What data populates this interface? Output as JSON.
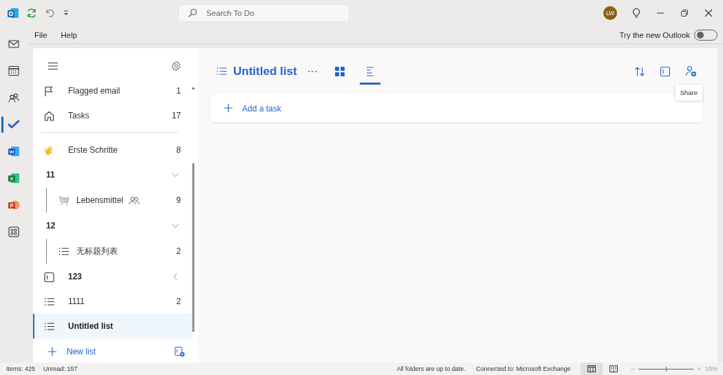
{
  "title_bar": {
    "search": {
      "placeholder": "Search To Do"
    },
    "avatar": "LW"
  },
  "menu_bar": {
    "items": [
      "File",
      "Help"
    ],
    "new_outlook": {
      "label": "Try the new Outlook",
      "on": false
    }
  },
  "app_rail": [
    {
      "kind": "mail",
      "selected": false
    },
    {
      "kind": "calendar",
      "selected": false
    },
    {
      "kind": "people",
      "selected": false
    },
    {
      "kind": "todo",
      "selected": true
    },
    {
      "kind": "word",
      "selected": false
    },
    {
      "kind": "excel",
      "selected": false
    },
    {
      "kind": "powerpoint",
      "selected": false
    },
    {
      "kind": "apps",
      "selected": false
    }
  ],
  "sidebar": {
    "lists": [
      {
        "kind": "flagged",
        "label": "Flagged email",
        "count": "1",
        "selected": false
      },
      {
        "kind": "tasks",
        "label": "Tasks",
        "count": "17",
        "selected": false
      },
      {
        "kind": "emoji",
        "label": "Erste Schritte",
        "count": "8",
        "selected": false
      },
      {
        "kind": "group",
        "label": "11",
        "expanded": true,
        "selected": false,
        "children": [
          {
            "kind": "cart",
            "label": "Lebensmittel",
            "shared": true,
            "count": "9",
            "selected": false
          }
        ]
      },
      {
        "kind": "group",
        "label": "12",
        "expanded": true,
        "selected": false,
        "children": [
          {
            "kind": "list",
            "label": "无标题列表",
            "shared": false,
            "count": "2",
            "selected": false
          }
        ]
      },
      {
        "kind": "group",
        "label": "123",
        "expanded": false,
        "selected": false
      },
      {
        "kind": "list",
        "label": "1111",
        "count": "2",
        "selected": false
      },
      {
        "kind": "list",
        "label": "Untitled list",
        "selected": true
      }
    ],
    "new_list": "New list"
  },
  "task_list": {
    "title": "Untitled list",
    "views": [
      {
        "kind": "grid",
        "selected": false
      },
      {
        "kind": "list",
        "selected": true
      }
    ],
    "tooltip": "Share",
    "add_task": {
      "placeholder": "Add a task"
    }
  },
  "status_bar": {
    "items": "Items: 425",
    "unread": "Unread: 157",
    "sync": "All folders are up to date.",
    "connection": "Connected to: Microsoft Exchange",
    "views": [
      {
        "kind": "normal",
        "selected": true
      },
      {
        "kind": "reading",
        "selected": false
      }
    ],
    "zoom": {
      "minus": "−",
      "plus": "+",
      "level": 0.5,
      "reading": "10%"
    }
  }
}
